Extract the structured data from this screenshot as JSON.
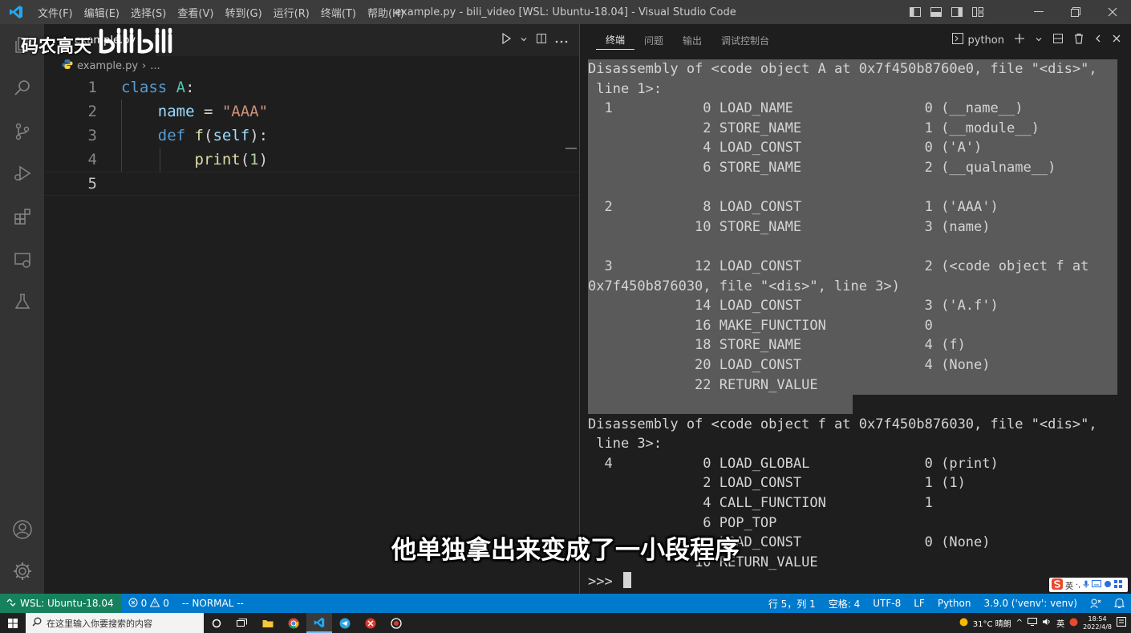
{
  "titlebar": {
    "menus": [
      "文件(F)",
      "编辑(E)",
      "选择(S)",
      "查看(V)",
      "转到(G)",
      "运行(R)",
      "终端(T)",
      "帮助(H)"
    ],
    "title": "example.py - bili_video [WSL: Ubuntu-18.04] - Visual Studio Code"
  },
  "watermark": {
    "text": "码农高天",
    "logo": "bilibili"
  },
  "editor": {
    "tab_label": "example.py",
    "breadcrumb_file": "example.py",
    "breadcrumb_more": "...",
    "lines": [
      {
        "n": "1",
        "tokens": [
          [
            "kw",
            "class"
          ],
          [
            "op",
            " "
          ],
          [
            "cls",
            "A"
          ],
          [
            "op",
            ":"
          ]
        ]
      },
      {
        "n": "2",
        "tokens": [
          [
            "op",
            "    "
          ],
          [
            "var",
            "name"
          ],
          [
            "op",
            " = "
          ],
          [
            "str",
            "\"AAA\""
          ]
        ]
      },
      {
        "n": "3",
        "tokens": [
          [
            "op",
            "    "
          ],
          [
            "kw",
            "def"
          ],
          [
            "op",
            " "
          ],
          [
            "fn",
            "f"
          ],
          [
            "op",
            "("
          ],
          [
            "var",
            "self"
          ],
          [
            "op",
            "):"
          ]
        ]
      },
      {
        "n": "4",
        "tokens": [
          [
            "op",
            "        "
          ],
          [
            "fn",
            "print"
          ],
          [
            "op",
            "("
          ],
          [
            "num",
            "1"
          ],
          [
            "op",
            ")"
          ]
        ]
      },
      {
        "n": "5",
        "tokens": []
      }
    ]
  },
  "panel": {
    "tabs": [
      "终端",
      "问题",
      "输出",
      "调试控制台"
    ],
    "active_tab": "终端",
    "terminal_name": "python",
    "lines": [
      "Disassembly of <code object A at 0x7f450b8760e0, file \"<dis>\",",
      " line 1>:",
      "  1           0 LOAD_NAME                0 (__name__)",
      "              2 STORE_NAME               1 (__module__)",
      "              4 LOAD_CONST               0 ('A')",
      "              6 STORE_NAME               2 (__qualname__)",
      "",
      "  2           8 LOAD_CONST               1 ('AAA')",
      "             10 STORE_NAME               3 (name)",
      "",
      "  3          12 LOAD_CONST               2 (<code object f at",
      "0x7f450b876030, file \"<dis>\", line 3>)",
      "             14 LOAD_CONST               3 ('A.f')",
      "             16 MAKE_FUNCTION            0",
      "             18 STORE_NAME               4 (f)",
      "             20 LOAD_CONST               4 (None)",
      "             22 RETURN_VALUE",
      "",
      "Disassembly of <code object f at 0x7f450b876030, file \"<dis>\",",
      " line 3>:",
      "  4           0 LOAD_GLOBAL              0 (print)",
      "              2 LOAD_CONST               1 (1)",
      "              4 CALL_FUNCTION            1",
      "              6 POP_TOP",
      "              8 LOAD_CONST               0 (None)",
      "             10 RETURN_VALUE"
    ],
    "prompt": ">>> "
  },
  "subtitle": "他单独拿出来变成了一小段程序",
  "statusbar": {
    "remote": "WSL: Ubuntu-18.04",
    "errors": "0",
    "warnings": "0",
    "mode": "-- NORMAL --",
    "position": "行 5，列 1",
    "spaces": "空格: 4",
    "encoding": "UTF-8",
    "eol": "LF",
    "language": "Python",
    "interpreter": "3.9.0 ('venv': venv)"
  },
  "taskbar": {
    "search_placeholder": "在这里输入你要搜索的内容",
    "weather": "31°C 晴朗",
    "ime_lang": "英",
    "time": "18:54",
    "date": "2022/4/8"
  },
  "ime": {
    "label": "英"
  },
  "colors": {
    "titlebar": "#3c3c3c",
    "activitybar": "#333333",
    "editor_bg": "#1e1e1e",
    "statusbar": "#007acc",
    "remote": "#16825d",
    "selection": "#5a5a5a"
  }
}
